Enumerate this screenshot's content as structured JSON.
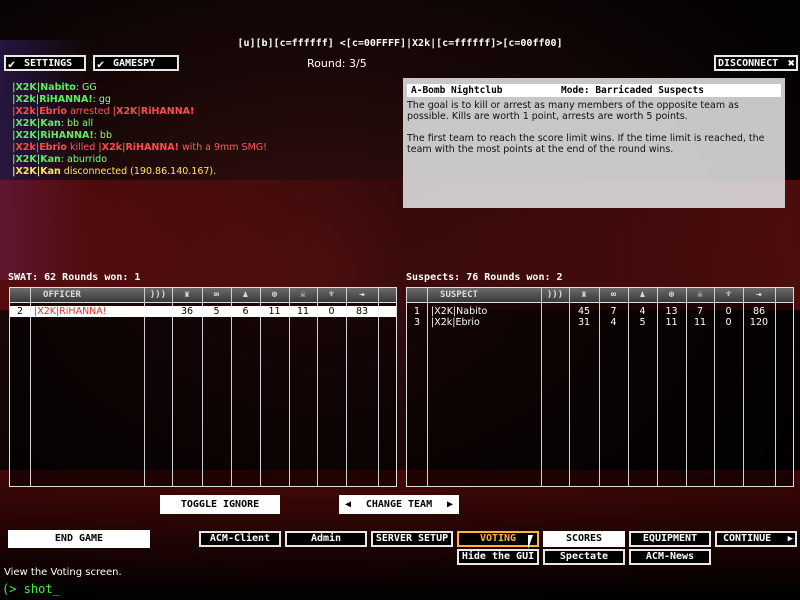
{
  "title": "[u][b][c=ffffff] <[c=00FFFF]|X2k|[c=ffffff]>[c=00ff00]",
  "round": "Round: 3/5",
  "buttons": {
    "settings": "SETTINGS",
    "gamespy": "GAMESPY",
    "disconnect": "DISCONNECT",
    "toggle_ignore": "TOGGLE IGNORE",
    "change_team": "CHANGE TEAM",
    "end_game": "END GAME",
    "acm_client": "ACM-Client",
    "admin": "Admin",
    "server_setup": "SERVER SETUP",
    "voting": "VOTING",
    "scores": "SCORES",
    "equipment": "EQUIPMENT",
    "continue": "CONTINUE",
    "hide_gui": "Hide the GUI",
    "spectate": "Spectate",
    "acm_news": "ACM-News"
  },
  "chat": [
    {
      "a": "|X2K|Nabito",
      "b": ": GG"
    },
    {
      "a": "|X2k|RiHANNA!",
      "b": ": gg"
    },
    {
      "a": "|X2k|Ebrio",
      "b": " arrested ",
      "c": "|X2K|RiHANNA!"
    },
    {
      "a": "|X2K|Kan",
      "b": ": bb all"
    },
    {
      "a": "|X2K|RiHANNA!",
      "b": ": bb"
    },
    {
      "a": "|X2k|Ebrio",
      "b": " killed ",
      "c": "|X2k|RiHANNA!",
      "d": " with a 9mm SMG!"
    },
    {
      "a": "|X2K|Kan",
      "b": ": aburrido"
    },
    {
      "a": "|X2K|Kan",
      "b": " disconnected (190.86.140.167)."
    }
  ],
  "info": {
    "map": "A-Bomb Nightclub",
    "mode": "Mode: Barricaded Suspects",
    "p1": "The goal is to kill or arrest as many members of the opposite team as possible.  Kills are worth 1 point, arrests are worth 5 points.",
    "p2": "The first team to reach the score limit wins.  If the time limit is reached, the team with the most points at the end of the round wins."
  },
  "swat": {
    "title": "SWAT: 62   Rounds won: 1",
    "header": "OFFICER",
    "rows": [
      {
        "num": "2",
        "name": "|X2K|RiHANNA!",
        "c1": "36",
        "c2": "5",
        "c3": "6",
        "c4": "11",
        "c5": "11",
        "c6": "0",
        "c7": "83"
      }
    ]
  },
  "suspects": {
    "title": "Suspects: 76   Rounds won: 2",
    "header": "SUSPECT",
    "rows": [
      {
        "num": "1",
        "name": "|X2K|Nabito",
        "c1": "45",
        "c2": "7",
        "c3": "4",
        "c4": "13",
        "c5": "7",
        "c6": "0",
        "c7": "86"
      },
      {
        "num": "3",
        "name": "|X2k|Ebrio",
        "c1": "31",
        "c2": "4",
        "c3": "5",
        "c4": "11",
        "c5": "11",
        "c6": "0",
        "c7": "120"
      }
    ]
  },
  "status": "View the Voting screen.",
  "console": "(> shot_"
}
